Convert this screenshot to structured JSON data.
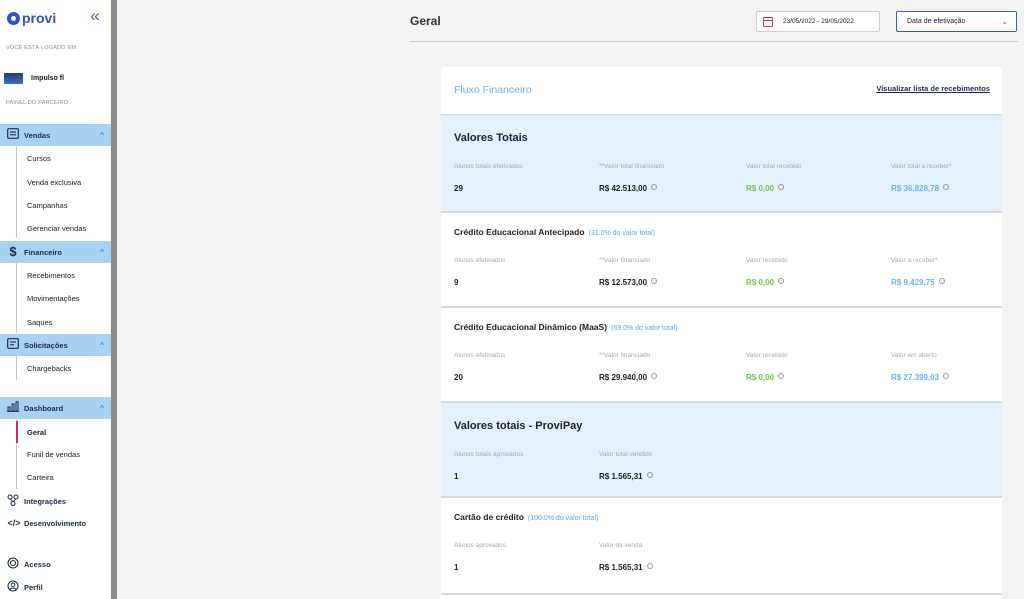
{
  "brand": {
    "logo_text": "provi"
  },
  "sidebar": {
    "collapse_glyph": "«",
    "located_label": "VOCÊ ESTÁ LOGADO EM:",
    "company_name": "Impulso fl",
    "partner_label": "PAINEL DO PARCEIRO",
    "groups": [
      {
        "label": "Vendas",
        "icon": "sales-icon",
        "items": [
          "Cursos",
          "Venda exclusiva",
          "Campanhas",
          "Gerenciar vendas"
        ]
      },
      {
        "label": "Financeiro",
        "icon": "dollar-icon",
        "items": [
          "Recebimentos",
          "Movimentações",
          "Saques"
        ]
      },
      {
        "label": "Solicitações",
        "icon": "requests-icon",
        "items": [
          "Chargebacks"
        ]
      },
      {
        "label": "Dashboard",
        "icon": "chart-icon",
        "items": [
          "Geral",
          "Funil de vendas",
          "Carteira"
        ]
      }
    ],
    "active_item": "Geral",
    "bottom_items": [
      {
        "label": "Integrações",
        "icon": "integrations-icon"
      },
      {
        "label": "Desenvolvimento",
        "icon": "code-icon"
      },
      {
        "label": "Acesso",
        "icon": "access-icon"
      },
      {
        "label": "Perfil",
        "icon": "profile-icon"
      }
    ]
  },
  "header": {
    "title": "Geral",
    "date_range": "23/05/2022 - 29/05/2022",
    "date_filter": "Data de efetivação"
  },
  "colors": {
    "accent": "#2e54cc",
    "highlight": "#e0245e",
    "light_blue": "#6fb3e6",
    "green": "#7bc24a",
    "nav_bg": "#a9d2f2",
    "section_bg": "#e4f1fc"
  },
  "card": {
    "title": "Fluxo Financeiro",
    "link": "Visualizar lista de recebimentos",
    "sections": [
      {
        "title": "Valores Totais",
        "pct": "",
        "columns": [
          {
            "label": "Alunos totais efetivados",
            "value": "29",
            "info": false,
            "tone": "dark"
          },
          {
            "label": "**Valor total financiado",
            "value": "R$ 42.513,00",
            "info": true,
            "tone": "dark"
          },
          {
            "label": "Valor total recebido",
            "value": "R$ 0,00",
            "info": true,
            "tone": "green"
          },
          {
            "label": "Valor total a receber*",
            "value": "R$ 36.828,78",
            "info": true,
            "tone": "blue"
          }
        ]
      },
      {
        "title": "Crédito Educacional Antecipado",
        "pct": "(31.0% do valor total)",
        "columns": [
          {
            "label": "Alunos efetivados",
            "value": "9",
            "info": false,
            "tone": "dark"
          },
          {
            "label": "**Valor financiado",
            "value": "R$ 12.573,00",
            "info": true,
            "tone": "dark"
          },
          {
            "label": "Valor recebido",
            "value": "R$ 0,00",
            "info": true,
            "tone": "green"
          },
          {
            "label": "Valor a receber*",
            "value": "R$ 9.429,75",
            "info": true,
            "tone": "blue"
          }
        ]
      },
      {
        "title": "Crédito Educacional Dinâmico (MaaS)",
        "pct": "(69.0% do valor total)",
        "columns": [
          {
            "label": "Alunos efetivados",
            "value": "20",
            "info": false,
            "tone": "dark"
          },
          {
            "label": "**Valor financiado",
            "value": "R$ 29.940,00",
            "info": true,
            "tone": "dark"
          },
          {
            "label": "Valor recebido",
            "value": "R$ 0,00",
            "info": true,
            "tone": "green"
          },
          {
            "label": "Valor em aberto",
            "value": "R$ 27.399,03",
            "info": true,
            "tone": "blue"
          }
        ]
      },
      {
        "title": "Valores totais - ProviPay",
        "pct": "",
        "columns": [
          {
            "label": "Alunos totais aprovados",
            "value": "1",
            "info": false,
            "tone": "dark"
          },
          {
            "label": "Valor total vendido",
            "value": "R$ 1.565,31",
            "info": true,
            "tone": "dark"
          }
        ]
      },
      {
        "title": "Cartão de crédito",
        "pct": "(100.0% do valor total)",
        "columns": [
          {
            "label": "Alunos aprovados",
            "value": "1",
            "info": false,
            "tone": "dark"
          },
          {
            "label": "Valor da venda",
            "value": "R$ 1.565,31",
            "info": true,
            "tone": "dark"
          }
        ]
      }
    ]
  }
}
